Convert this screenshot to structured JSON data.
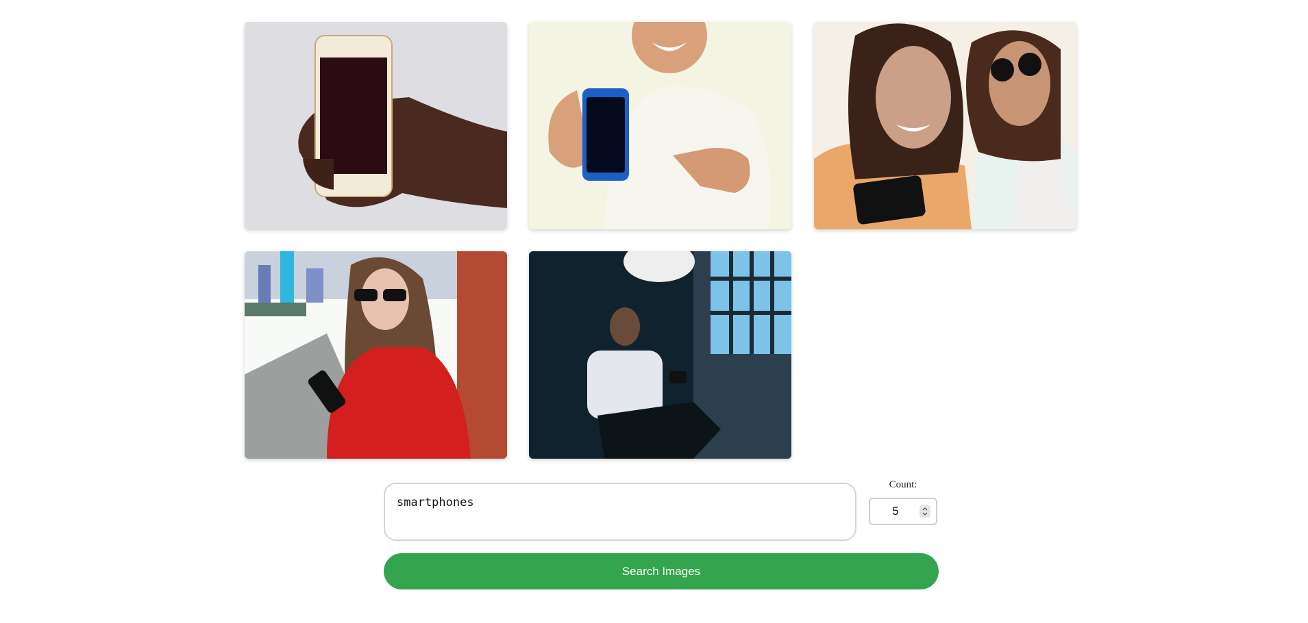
{
  "results": {
    "images": [
      {
        "subject": "hand holding white smartphone",
        "bg": "#dedde2"
      },
      {
        "subject": "man pointing at blue smartphone",
        "bg": "#f3f4e2"
      },
      {
        "subject": "two women looking at phone",
        "bg": "#e9a86a"
      },
      {
        "subject": "woman in red sweater using phone",
        "bg": "#c9d1dc"
      },
      {
        "subject": "man on phone in dark room",
        "bg": "#10222e"
      }
    ]
  },
  "search": {
    "query_value": "smartphones",
    "count_label": "Count:",
    "count_value": "5",
    "button_label": "Search Images"
  },
  "colors": {
    "accent": "#34a54e",
    "input_border": "#d4d4d4"
  }
}
